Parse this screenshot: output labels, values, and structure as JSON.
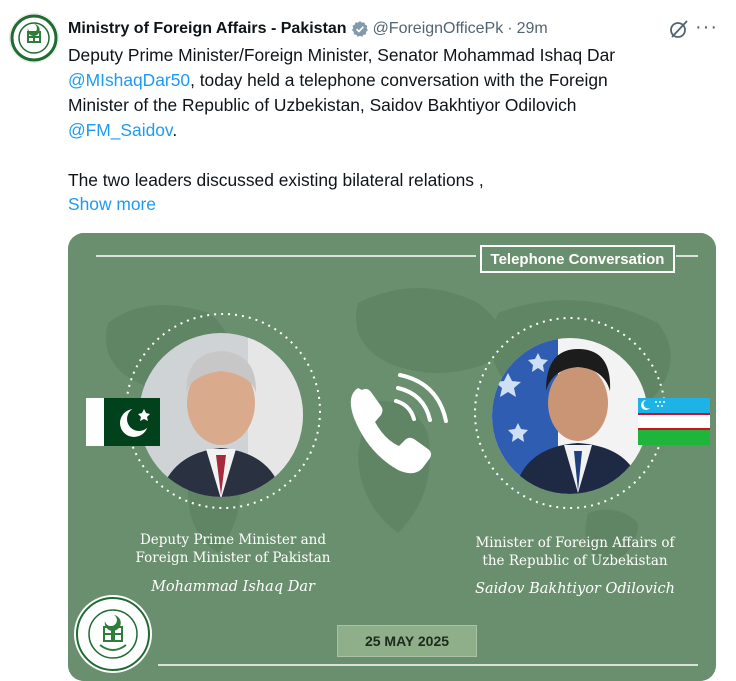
{
  "tweet": {
    "author_name": "Ministry of Foreign Affairs - Pakistan",
    "handle": "@ForeignOfficePk",
    "separator": "·",
    "time": "29m",
    "more_glyph": "···",
    "text_line1": "Deputy Prime Minister/Foreign Minister, Senator Mohammad Ishaq Dar",
    "mention1": "@MIshaqDar50",
    "text_line2": ", today held a telephone conversation with the Foreign",
    "text_line3": "Minister of the Republic of Uzbekistan, Saidov Bakhtiyor Odilovich",
    "mention2": "@FM_Saidov",
    "text_line4_end": ".",
    "text_para2": "The two leaders discussed existing bilateral relations ,",
    "show_more": "Show more"
  },
  "card": {
    "tag": "Telephone Conversation",
    "left_caption_line1": "Deputy Prime Minister and",
    "left_caption_line2": "Foreign Minister of Pakistan",
    "left_signature": "Mohammad Ishaq Dar",
    "right_caption_line1": "Minister of Foreign Affairs of",
    "right_caption_line2": "the Republic of Uzbekistan",
    "right_signature": "Saidov Bakhtiyor Odilovich",
    "date": "25 MAY 2025",
    "emblem_text_top": "MINISTRY OF FOREIGN AFFAIRS",
    "emblem_text_bottom": "GOVERNMENT OF PAKISTAN"
  },
  "colors": {
    "card_green": "#6a8f6e",
    "link_blue": "#1d9bf0",
    "pk_green": "#01411c",
    "uz_blue": "#1eb3e6",
    "uz_green": "#1eb53a"
  },
  "icons": [
    "verified-badge-icon",
    "grok-icon",
    "more-options-icon",
    "phone-icon",
    "pakistan-flag",
    "uzbekistan-flag",
    "ministry-emblem"
  ]
}
